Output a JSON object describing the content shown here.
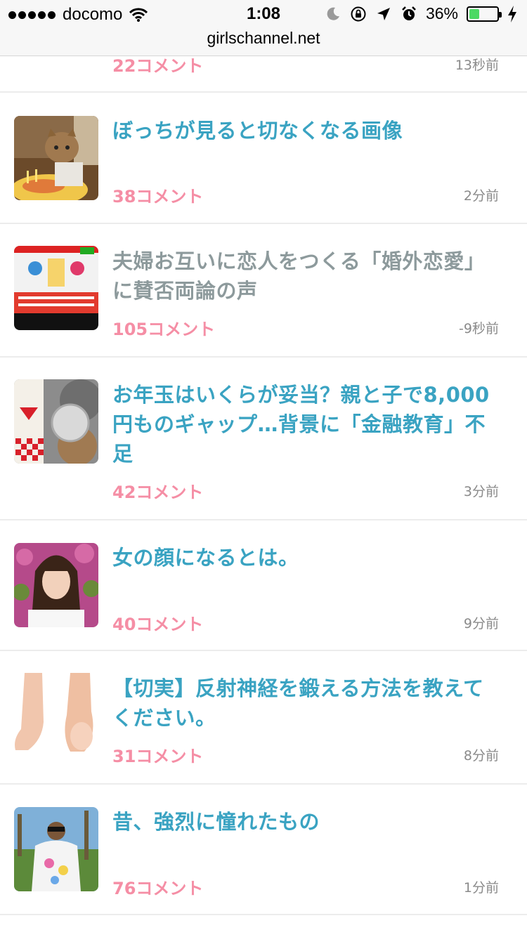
{
  "status": {
    "carrier": "docomo",
    "time": "1:08",
    "battery_percent": "36%",
    "battery_level": 0.36,
    "battery_color": "#4cd964"
  },
  "browser": {
    "url": "girlschannel.net"
  },
  "colors": {
    "title": "#3aa3c2",
    "visited_title": "#8d9a9c",
    "comments": "#f58ea5"
  },
  "topics": [
    {
      "title": "",
      "comments": "22コメント",
      "time": "13秒前",
      "visited": false,
      "image": "partial"
    },
    {
      "title": "ぼっちが見ると切なくなる画像",
      "comments": "38コメント",
      "time": "2分前",
      "visited": false,
      "image": "cat-cake"
    },
    {
      "title": "夫婦お互いに恋人をつくる「婚外恋愛」に賛否両論の声",
      "comments": "105コメント",
      "time": "-9秒前",
      "visited": true,
      "image": "tv-caption"
    },
    {
      "title": "お年玉はいくらが妥当？親と子で8,000円ものギャップ…背景に「金融教育」不足",
      "comments": "42コメント",
      "time": "3分前",
      "visited": false,
      "image": "coins"
    },
    {
      "title": "女の顔になるとは。",
      "comments": "40コメント",
      "time": "9分前",
      "visited": false,
      "image": "woman"
    },
    {
      "title": "【切実】反射神経を鍛える方法を教えてください。",
      "comments": "31コメント",
      "time": "8分前",
      "visited": false,
      "image": "feet"
    },
    {
      "title": "昔、強烈に憧れたもの",
      "comments": "76コメント",
      "time": "1分前",
      "visited": false,
      "image": "man-shirt"
    }
  ]
}
